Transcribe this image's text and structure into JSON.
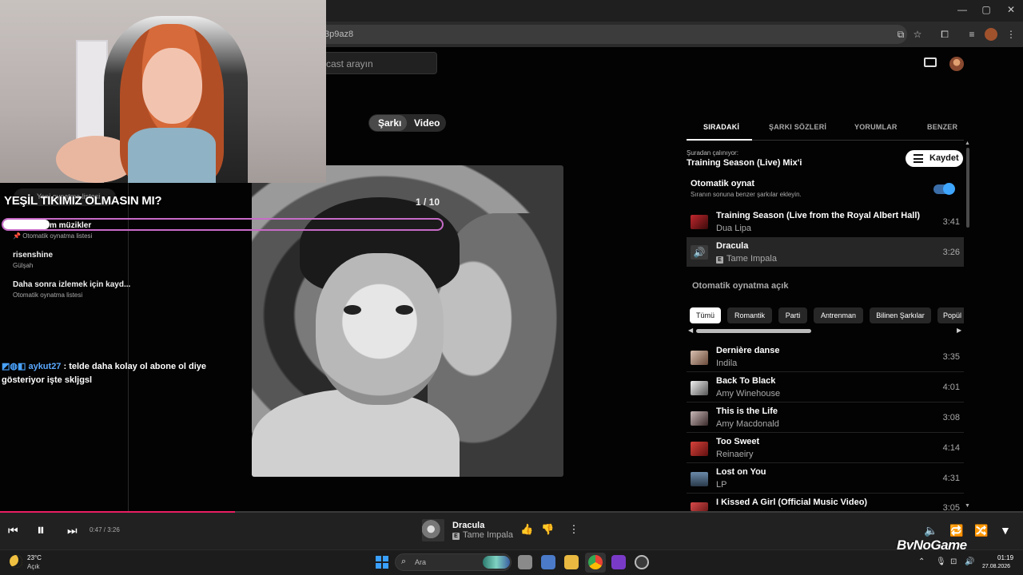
{
  "browser": {
    "url": "3p9az8",
    "window_controls": [
      "—",
      "▢",
      "✕"
    ]
  },
  "header": {
    "search_placeholder": "cast arayın"
  },
  "toggle": {
    "song": "Şarkı",
    "video": "Video"
  },
  "overlay": {
    "title": "YEŞİL TIKIMIZ OLMASIN MI?",
    "new_list": "Yeni oynatma listesi",
    "pager": "1 / 10",
    "highlight_text": "m müzikler",
    "pin_sub": "Otomatik oynatma listesi",
    "chat_user": "aykut27",
    "chat_msg": " : telde daha kolay ol abone ol diye gösteriyor işte skljgsl"
  },
  "sidebar": {
    "items": [
      {
        "title": "risenshine",
        "sub": "Gülşah"
      },
      {
        "title": "Daha sonra izlemek için kayd...",
        "sub": "Otomatik oynatma listesi"
      }
    ]
  },
  "panel": {
    "tabs": [
      "SIRADAKİ",
      "ŞARKI SÖZLERİ",
      "YORUMLAR",
      "BENZER"
    ],
    "playing_from_label": "Şuradan çalınıyor:",
    "playing_from": "Training Season (Live) Mix'i",
    "save": "Kaydet",
    "autoplay_title": "Otomatik oynat",
    "autoplay_sub": "Sıranın sonuna benzer şarkılar ekleyin.",
    "autoplay_on": true,
    "queue": [
      {
        "title": "Training Season (Live from the Royal Albert Hall)",
        "artist": "Dua Lipa",
        "time": "3:41",
        "explicit": false,
        "color": "#c0272d"
      },
      {
        "title": "Dracula",
        "artist": "Tame Impala",
        "time": "3:26",
        "explicit": true,
        "color": "#3a3a3a"
      }
    ],
    "autoplay_on_label": "Otomatik oynatma açık",
    "chips": [
      "Tümü",
      "Romantik",
      "Parti",
      "Antrenman",
      "Bilinen Şarkılar",
      "Popül"
    ],
    "up_next": [
      {
        "title": "Dernière danse",
        "artist": "Indila",
        "time": "3:35",
        "color": "#b89a8a"
      },
      {
        "title": "Back To Black",
        "artist": "Amy Winehouse",
        "time": "4:01",
        "color": "#d8d8d8"
      },
      {
        "title": "This is the Life",
        "artist": "Amy Macdonald",
        "time": "3:08",
        "color": "#9a8a8a"
      },
      {
        "title": "Too Sweet",
        "artist": "Reinaeiry",
        "time": "4:14",
        "color": "#b8322a"
      },
      {
        "title": "Lost on You",
        "artist": "LP",
        "time": "4:31",
        "color": "#4a6a8a"
      },
      {
        "title": "I Kissed A Girl (Official Music Video)",
        "artist": "",
        "time": "3:05",
        "color": "#c04040"
      }
    ]
  },
  "player": {
    "time": "0:47 / 3:26",
    "progress": 0.23,
    "title": "Dracula",
    "artist": "Tame Impala"
  },
  "watermark": "ByNoGame",
  "taskbar": {
    "temp": "23°C",
    "weather": "Açık",
    "search": "Ara",
    "time": "01:19",
    "date": "27.08.2026"
  }
}
